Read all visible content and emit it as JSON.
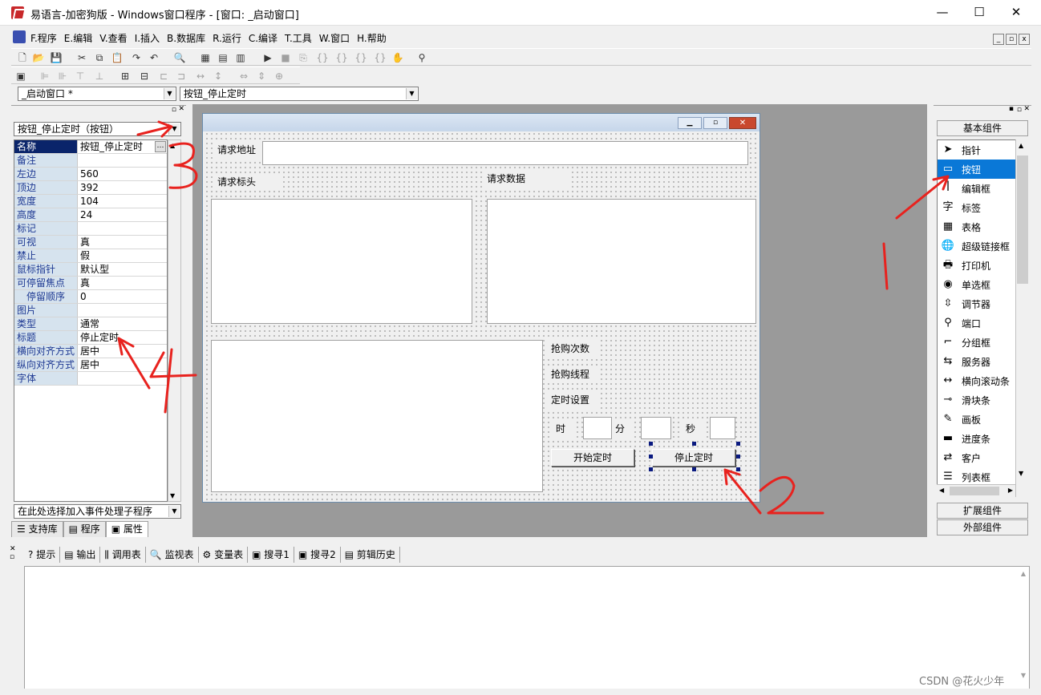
{
  "window": {
    "title": "易语言-加密狗版 - Windows窗口程序 - [窗口: _启动窗口]",
    "min_label": "—",
    "max_label": "☐",
    "close_label": "✕"
  },
  "menu": [
    "F.程序",
    "E.编辑",
    "V.查看",
    "I.插入",
    "B.数据库",
    "R.运行",
    "C.编译",
    "T.工具",
    "W.窗口",
    "H.帮助"
  ],
  "selectors": {
    "window_select": "_启动窗口 *",
    "sub_select": "按钮_停止定时"
  },
  "property_panel": {
    "object_select": "按钮_停止定时（按钮）",
    "event_select": "在此处选择加入事件处理子程序",
    "ellipsis": "…",
    "rows": [
      {
        "name": "名称",
        "value": "按钮_停止定时"
      },
      {
        "name": "备注",
        "value": ""
      },
      {
        "name": "左边",
        "value": "560"
      },
      {
        "name": "顶边",
        "value": "392"
      },
      {
        "name": "宽度",
        "value": "104"
      },
      {
        "name": "高度",
        "value": "24"
      },
      {
        "name": "标记",
        "value": ""
      },
      {
        "name": "可视",
        "value": "真"
      },
      {
        "name": "禁止",
        "value": "假"
      },
      {
        "name": "鼠标指针",
        "value": "默认型"
      },
      {
        "name": "可停留焦点",
        "value": "真"
      },
      {
        "name": "停留顺序",
        "value": "0"
      },
      {
        "name": "图片",
        "value": ""
      },
      {
        "name": "类型",
        "value": "通常"
      },
      {
        "name": "标题",
        "value": "停止定时"
      },
      {
        "name": "横向对齐方式",
        "value": "居中"
      },
      {
        "name": "纵向对齐方式",
        "value": "居中"
      },
      {
        "name": "字体",
        "value": ""
      }
    ],
    "tabs": [
      "支持库",
      "程序",
      "属性"
    ]
  },
  "form": {
    "url_label": "请求地址",
    "header_label": "请求标头",
    "data_label": "请求数据",
    "count_label": "抢购次数",
    "thread_label": "抢购线程",
    "timer_label": "定时设置",
    "hour_label": "时",
    "minute_label": "分",
    "second_label": "秒",
    "start_button": "开始定时",
    "stop_button": "停止定时"
  },
  "components": {
    "basic_group": "基本组件",
    "ext_group": "扩展组件",
    "external_group": "外部组件",
    "items": [
      {
        "label": "指针",
        "icon": "pointer-icon"
      },
      {
        "label": "按钮",
        "icon": "button-icon"
      },
      {
        "label": "编辑框",
        "icon": "editbox-icon"
      },
      {
        "label": "标签",
        "icon": "label-icon"
      },
      {
        "label": "表格",
        "icon": "table-icon"
      },
      {
        "label": "超级链接框",
        "icon": "hyperlink-icon"
      },
      {
        "label": "打印机",
        "icon": "printer-icon"
      },
      {
        "label": "单选框",
        "icon": "radio-icon"
      },
      {
        "label": "调节器",
        "icon": "spinner-icon"
      },
      {
        "label": "端口",
        "icon": "port-icon"
      },
      {
        "label": "分组框",
        "icon": "groupbox-icon"
      },
      {
        "label": "服务器",
        "icon": "server-icon"
      },
      {
        "label": "横向滚动条",
        "icon": "hscroll-icon"
      },
      {
        "label": "滑块条",
        "icon": "slider-icon"
      },
      {
        "label": "画板",
        "icon": "canvas-icon"
      },
      {
        "label": "进度条",
        "icon": "progress-icon"
      },
      {
        "label": "客户",
        "icon": "client-icon"
      },
      {
        "label": "列表框",
        "icon": "listbox-icon"
      }
    ]
  },
  "bottom_tabs": [
    "提示",
    "输出",
    "调用表",
    "监视表",
    "变量表",
    "搜寻1",
    "搜寻2",
    "剪辑历史"
  ],
  "watermark": "CSDN @花火少年",
  "annotations": [
    "1",
    "2",
    "3",
    "4"
  ]
}
